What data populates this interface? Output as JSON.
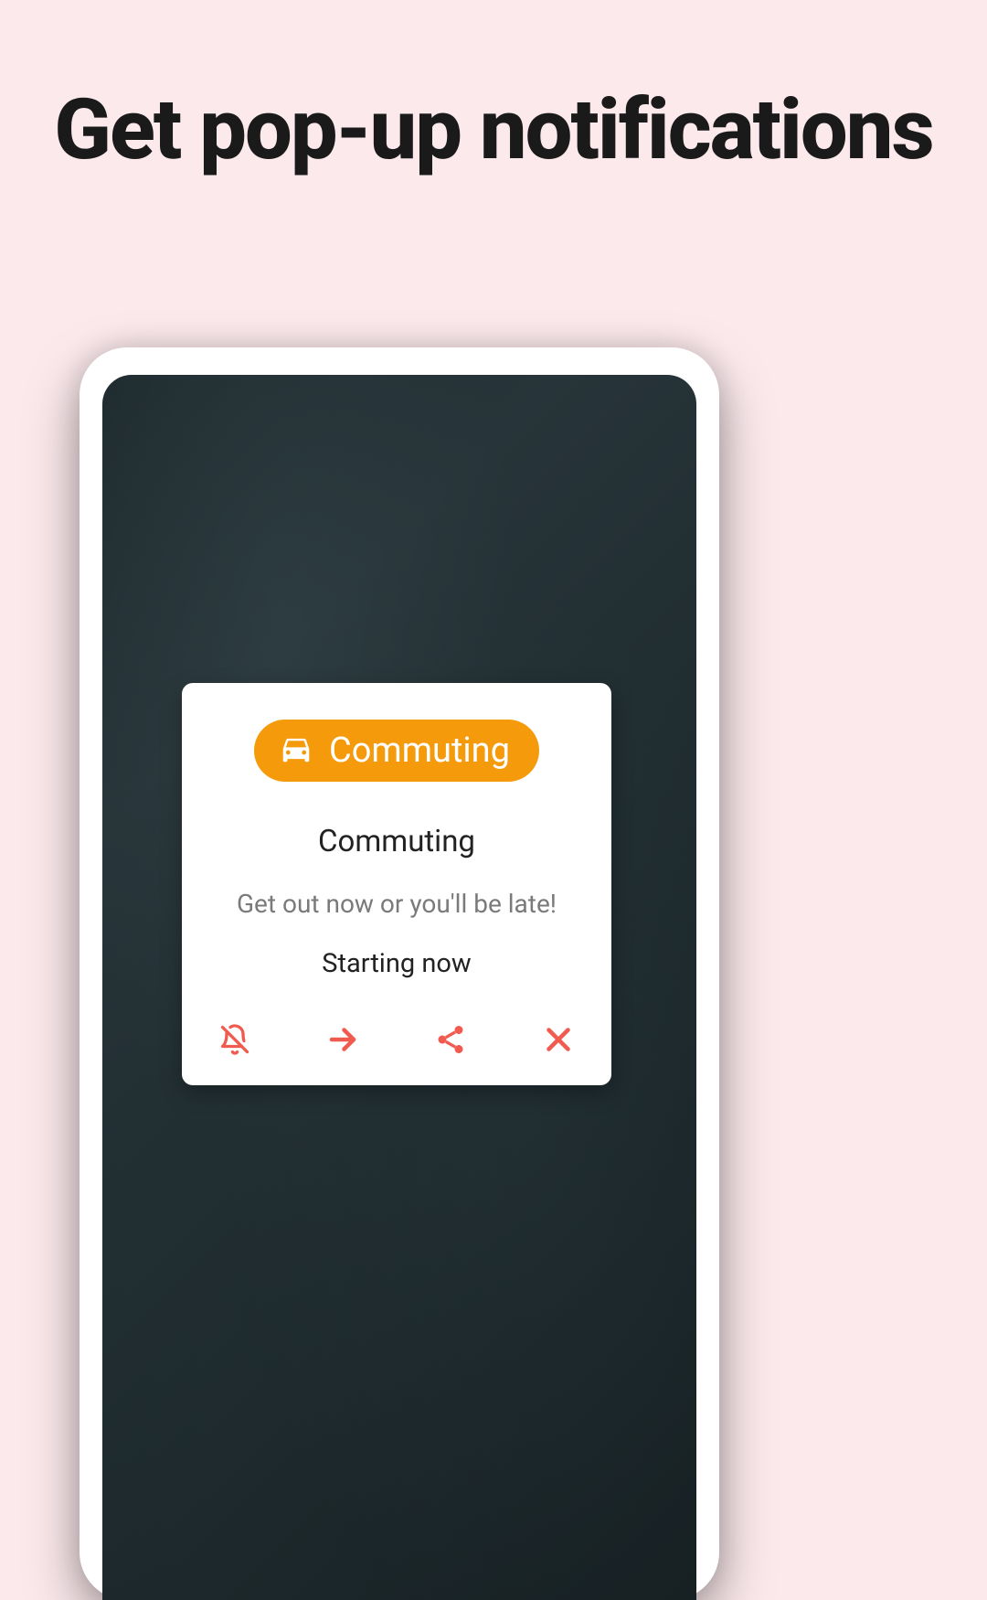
{
  "headline": "Get pop-up notifications",
  "notification": {
    "pill_label": "Commuting",
    "title": "Commuting",
    "body": "Get out now or you'll be late!",
    "status": "Starting now"
  },
  "colors": {
    "accent": "#f59a0a",
    "action_icon": "#f05a4f"
  },
  "icons": {
    "pill": "car-icon",
    "actions": [
      "bell-off-icon",
      "arrow-right-icon",
      "share-icon",
      "close-icon"
    ]
  }
}
